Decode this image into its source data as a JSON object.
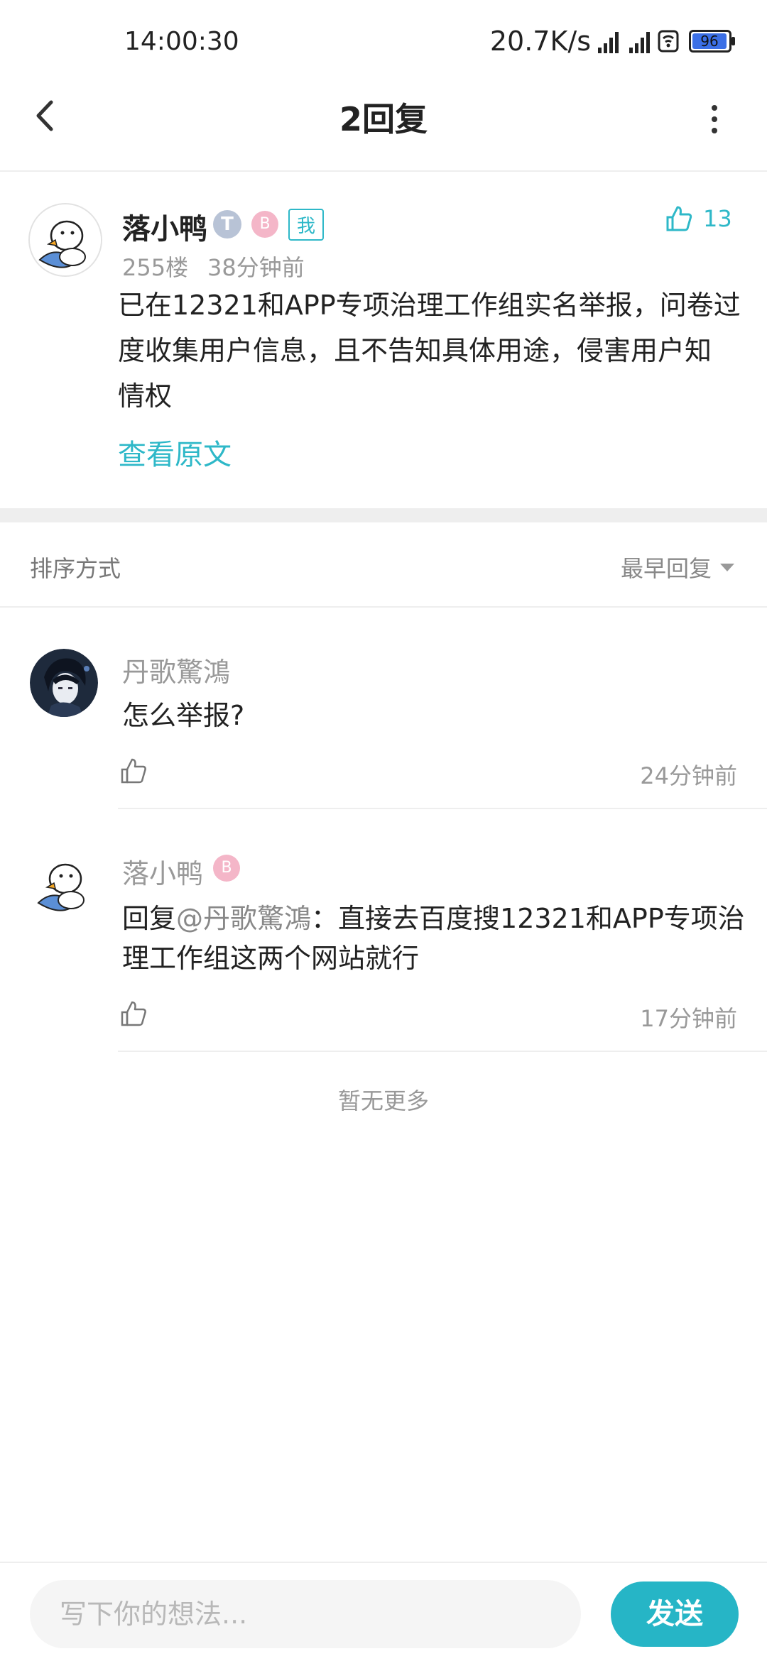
{
  "status_bar": {
    "time": "14:00:30",
    "speed": "20.7K/s",
    "battery": "96"
  },
  "nav": {
    "title": "2回复"
  },
  "post": {
    "username": "落小鸭",
    "badge_t": "T",
    "badge_e": "B",
    "badge_me": "我",
    "likes": "13",
    "floor": "255楼",
    "time": "38分钟前",
    "text_lines": [
      "已在12321和APP专项治理工作组实名举报，问卷过",
      "度收集用户信息，且不告知具体用途，侵害用户知",
      "情权"
    ],
    "view_original": "查看原文"
  },
  "sort": {
    "label": "排序方式",
    "value": "最早回复"
  },
  "replies": [
    {
      "username": "丹歌驚鴻",
      "text": "怎么举报?",
      "time": "24分钟前"
    },
    {
      "username": "落小鸭",
      "badge": "B",
      "prefix": "回复",
      "mention": "@丹歌驚鴻",
      "text_line1": "：直接去百度搜12321和APP专项治",
      "text_line2": "理工作组这两个网站就行",
      "time": "17分钟前"
    }
  ],
  "no_more": "暂无更多",
  "composer": {
    "placeholder": "写下你的想法...",
    "send_label": "发送"
  },
  "colors": {
    "accent": "#26b5c6",
    "separator": "#eeeeee"
  }
}
